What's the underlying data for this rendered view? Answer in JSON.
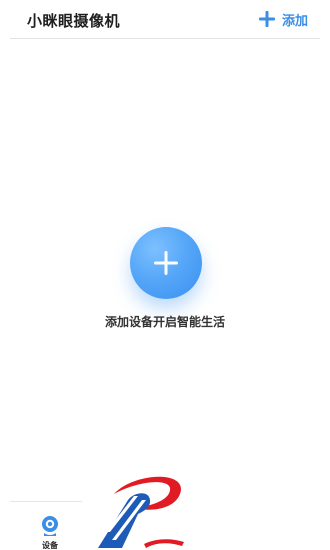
{
  "header": {
    "title": "小眯眼摄像机",
    "add_label": "添加"
  },
  "main": {
    "add_prompt": "添加设备开启智能生活"
  },
  "tabbar": {
    "device_label": "设备"
  },
  "colors": {
    "accent": "#3a8ee6",
    "button_gradient_start": "#7ec0ff",
    "button_gradient_end": "#3a8ff0",
    "text_primary": "#1f1f1f"
  }
}
